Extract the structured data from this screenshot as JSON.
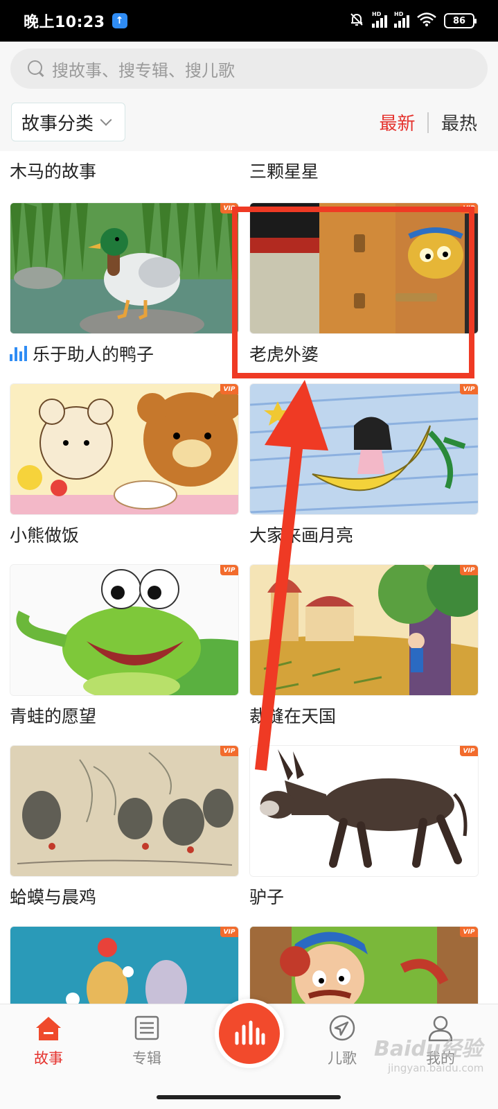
{
  "status_bar": {
    "time": "晚上10:23",
    "upload_icon": "upload-arrow-icon",
    "hd_label": "HD",
    "battery": "86"
  },
  "search": {
    "placeholder": "搜故事、搜专辑、搜儿歌"
  },
  "filter": {
    "category_label": "故事分类",
    "sort_tabs": [
      {
        "label": "最新",
        "active": true
      },
      {
        "label": "最热",
        "active": false
      }
    ]
  },
  "top_row": [
    {
      "title": "木马的故事"
    },
    {
      "title": "三颗星星"
    }
  ],
  "vip_label": "VIP",
  "stories": [
    {
      "title": "乐于助人的鸭子",
      "playing": true,
      "image": "duck-by-pond"
    },
    {
      "title": "老虎外婆",
      "playing": false,
      "image": "tiger-behind-door"
    },
    {
      "title": "小熊做饭",
      "playing": false,
      "image": "cartoon-bears"
    },
    {
      "title": "大家来画月亮",
      "playing": false,
      "image": "girl-on-moon"
    },
    {
      "title": "青蛙的愿望",
      "playing": false,
      "image": "cartoon-frog"
    },
    {
      "title": "裁缝在天国",
      "playing": false,
      "image": "tailor-under-tree"
    },
    {
      "title": "蛤蟆与晨鸡",
      "playing": false,
      "image": "ink-chickens"
    },
    {
      "title": "驴子",
      "playing": false,
      "image": "donkey"
    },
    {
      "title": "",
      "playing": false,
      "image": "mice"
    },
    {
      "title": "",
      "playing": false,
      "image": "mustache-man"
    }
  ],
  "tab_bar": {
    "items": [
      {
        "label": "故事",
        "icon": "home-icon",
        "active": true
      },
      {
        "label": "专辑",
        "icon": "album-list-icon",
        "active": false
      },
      {
        "label": "儿歌",
        "icon": "navigation-arrow-icon",
        "active": false
      },
      {
        "label": "我的",
        "icon": "user-profile-icon",
        "active": false
      }
    ],
    "center_icon": "sound-wave-play-icon"
  },
  "watermark": {
    "brand": "Baidu经验",
    "url": "jingyan.baidu.com"
  },
  "colors": {
    "accent": "#e5322d",
    "annotation": "#ef3a24",
    "vip": "#f26b2c",
    "playing": "#2f8cf4"
  }
}
